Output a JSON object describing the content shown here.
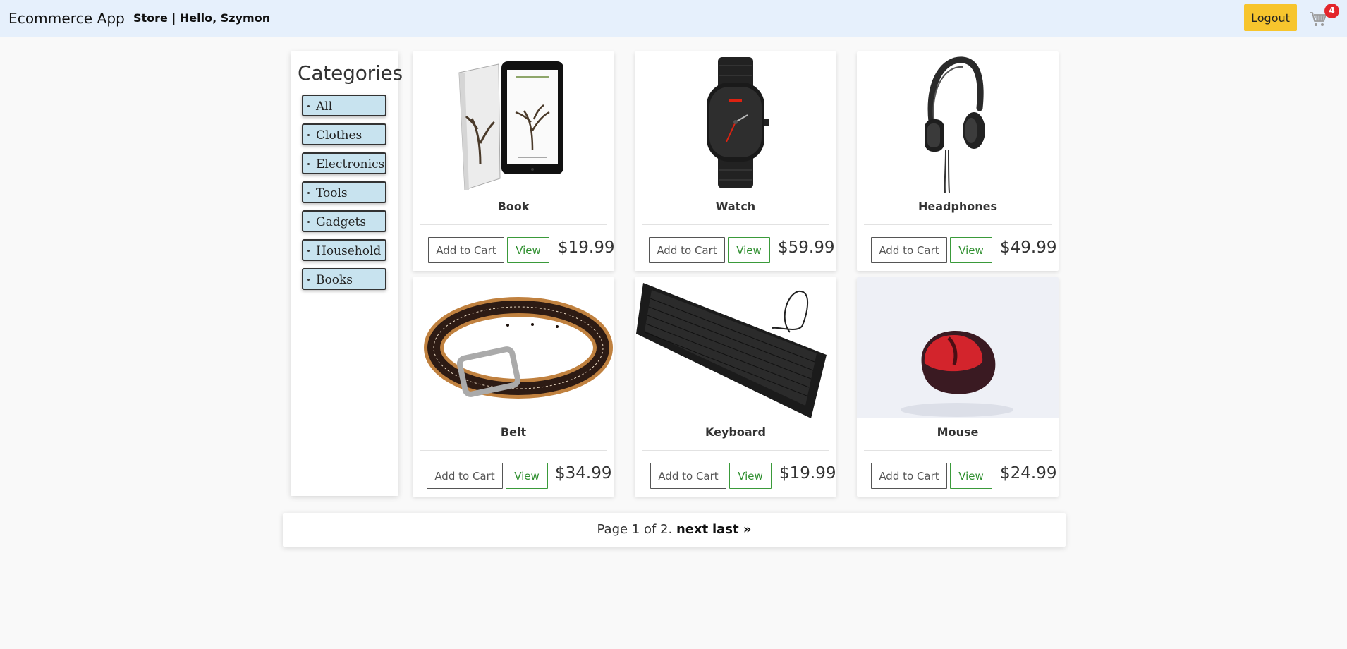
{
  "navbar": {
    "brand": "Ecommerce App",
    "store_link": "Store",
    "separator": "|",
    "greeting": "Hello, Szymon",
    "logout_label": "Logout",
    "cart_icon": "shopping-cart-icon",
    "cart_count": "4",
    "accent_color": "#f7c52d",
    "badge_color": "#e3262c"
  },
  "sidebar": {
    "title": "Categories",
    "categories": [
      {
        "label": "All"
      },
      {
        "label": "Clothes"
      },
      {
        "label": "Electronics"
      },
      {
        "label": "Tools"
      },
      {
        "label": "Gadgets"
      },
      {
        "label": "Household"
      },
      {
        "label": "Books"
      }
    ],
    "category_color": "#c8e3ef"
  },
  "products": [
    {
      "name": "Book",
      "price": "$19.99",
      "add_label": "Add to Cart",
      "view_label": "View",
      "image": "book-image"
    },
    {
      "name": "Watch",
      "price": "$59.99",
      "add_label": "Add to Cart",
      "view_label": "View",
      "image": "watch-image"
    },
    {
      "name": "Headphones",
      "price": "$49.99",
      "add_label": "Add to Cart",
      "view_label": "View",
      "image": "headphones-image"
    },
    {
      "name": "Belt",
      "price": "$34.99",
      "add_label": "Add to Cart",
      "view_label": "View",
      "image": "belt-image"
    },
    {
      "name": "Keyboard",
      "price": "$19.99",
      "add_label": "Add to Cart",
      "view_label": "View",
      "image": "keyboard-image"
    },
    {
      "name": "Mouse",
      "price": "$24.99",
      "add_label": "Add to Cart",
      "view_label": "View",
      "image": "mouse-image"
    }
  ],
  "pagination": {
    "text": "Page 1 of 2.",
    "next_label": "next",
    "last_label": "last »"
  }
}
